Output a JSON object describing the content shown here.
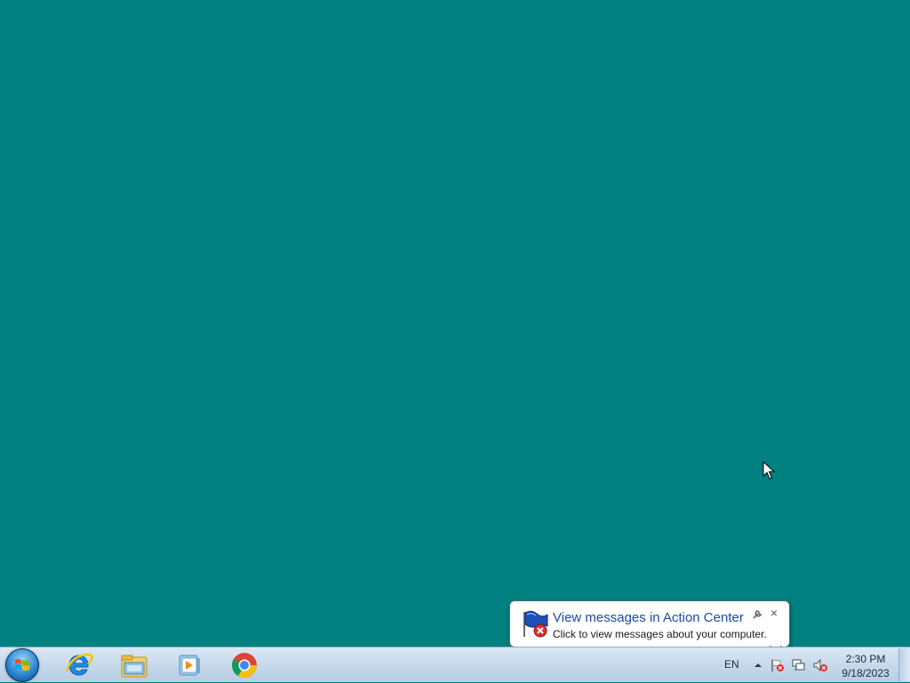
{
  "desktop": {
    "background_color": "#008080"
  },
  "taskbar": {
    "start_icon": "windows-orb-icon",
    "pinned": [
      {
        "name": "internet-explorer-icon"
      },
      {
        "name": "file-explorer-icon"
      },
      {
        "name": "media-player-icon"
      },
      {
        "name": "chrome-icon"
      }
    ],
    "tray": {
      "language": "EN",
      "icons": [
        "show-hidden-icons-arrow",
        "action-center-flag-error-icon",
        "network-icon",
        "volume-muted-icon"
      ],
      "time": "2:30 PM",
      "date": "9/18/2023"
    }
  },
  "balloon": {
    "title": "View messages in Action Center",
    "text": "Click to view messages about your computer.",
    "close": "×"
  }
}
